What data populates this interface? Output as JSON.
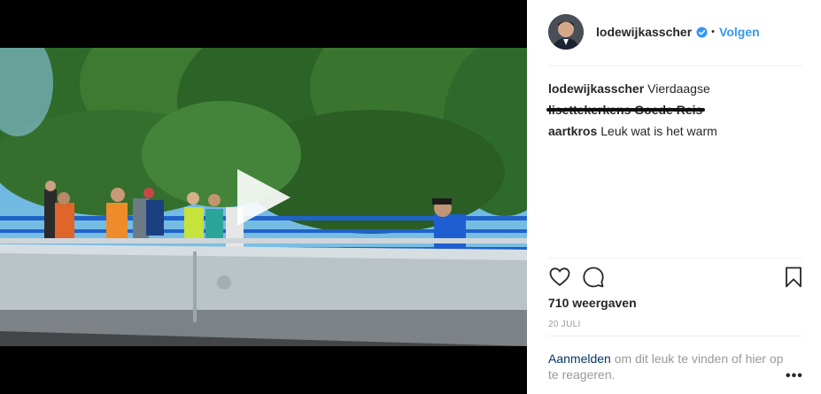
{
  "post": {
    "username": "lodewijkasscher",
    "separator": "•",
    "follow_label": "Volgen",
    "verified_icon": "verified-badge-icon",
    "accent_color": "#3897f0"
  },
  "comments": [
    {
      "author": "lodewijkasscher",
      "text": "Vierdaagse",
      "continuation": "lisettekerkens Goede Reis"
    },
    {
      "author": "aartkros",
      "text": "Leuk wat is het warm"
    }
  ],
  "actions": {
    "like_icon": "heart-icon",
    "comment_icon": "comment-icon",
    "save_icon": "bookmark-icon"
  },
  "stats": {
    "views": "710 weergaven",
    "date": "20 JULI"
  },
  "login": {
    "link": "Aanmelden",
    "text": " om dit leuk te vinden of hier op te reageren.",
    "more": "•••"
  },
  "video": {
    "play_icon": "play-icon"
  }
}
